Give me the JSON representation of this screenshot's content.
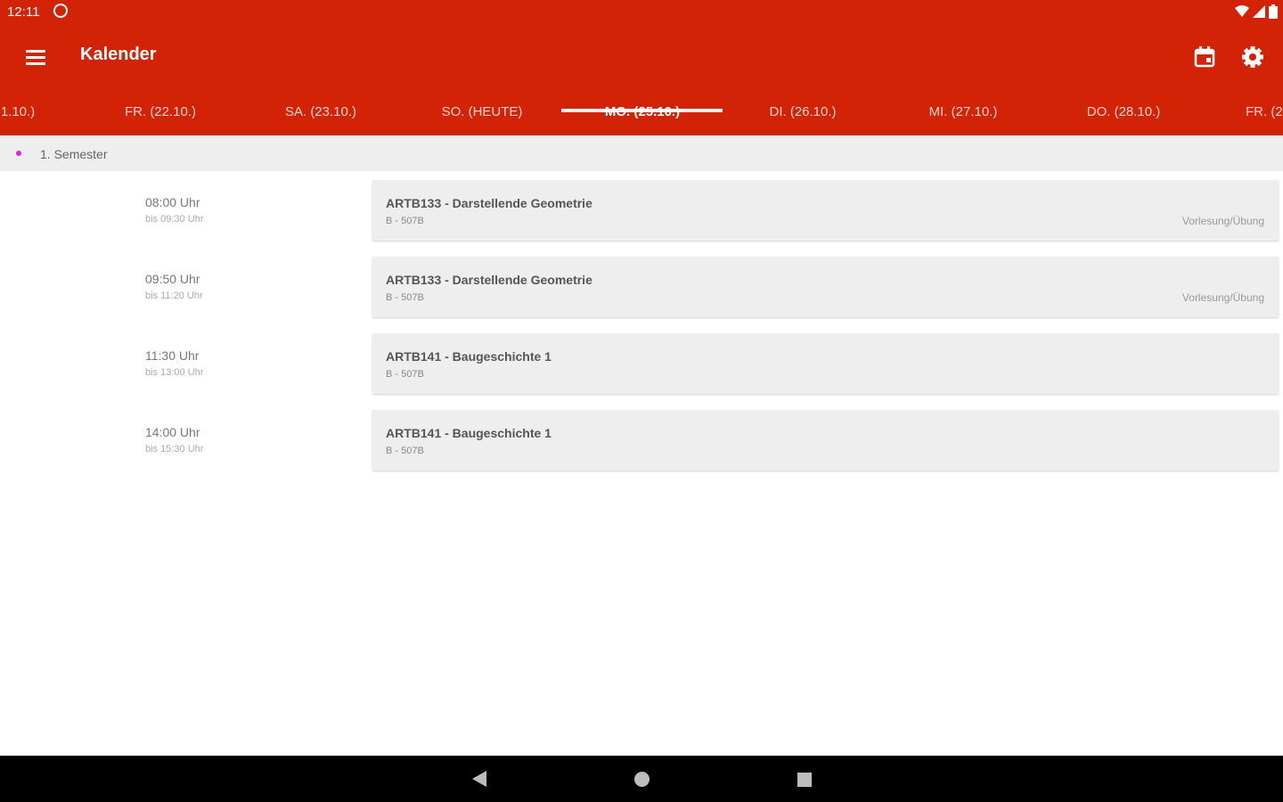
{
  "status_bar": {
    "time": "12:11",
    "icons": [
      "app-notification-icon",
      "wifi-icon",
      "signal-icon",
      "battery-icon"
    ]
  },
  "app_bar": {
    "title": "Kalender",
    "icons": [
      "menu-icon",
      "calendar-icon",
      "settings-icon"
    ],
    "color": "#d32307"
  },
  "tabs": [
    {
      "label": "1.10.)"
    },
    {
      "label": "FR. (22.10.)"
    },
    {
      "label": "SA. (23.10.)"
    },
    {
      "label": "SO. (HEUTE)"
    },
    {
      "label": "MO. (25.10.)"
    },
    {
      "label": "DI. (26.10.)"
    },
    {
      "label": "MI. (27.10.)"
    },
    {
      "label": "DO. (28.10.)"
    },
    {
      "label": "FR. (2"
    }
  ],
  "active_tab": "MO. (25.10.)",
  "section": {
    "label": "1. Semester",
    "dot_color": "#e020e0"
  },
  "events": [
    {
      "start": "08:00 Uhr",
      "end": "bis 09:30 Uhr",
      "title": "ARTB133 - Darstellende Geometrie",
      "room": "B - 507B",
      "type": "Vorlesung/Übung"
    },
    {
      "start": "09:50 Uhr",
      "end": "bis 11:20 Uhr",
      "title": "ARTB133 - Darstellende Geometrie",
      "room": "B - 507B",
      "type": "Vorlesung/Übung"
    },
    {
      "start": "11:30 Uhr",
      "end": "bis 13:00 Uhr",
      "title": "ARTB141 - Baugeschichte 1",
      "room": "B - 507B",
      "type": ""
    },
    {
      "start": "14:00 Uhr",
      "end": "bis 15:30 Uhr",
      "title": "ARTB141 - Baugeschichte 1",
      "room": "B - 507B",
      "type": ""
    }
  ],
  "nav_bar": {
    "icons": [
      "back-icon",
      "home-icon",
      "recents-icon"
    ]
  }
}
